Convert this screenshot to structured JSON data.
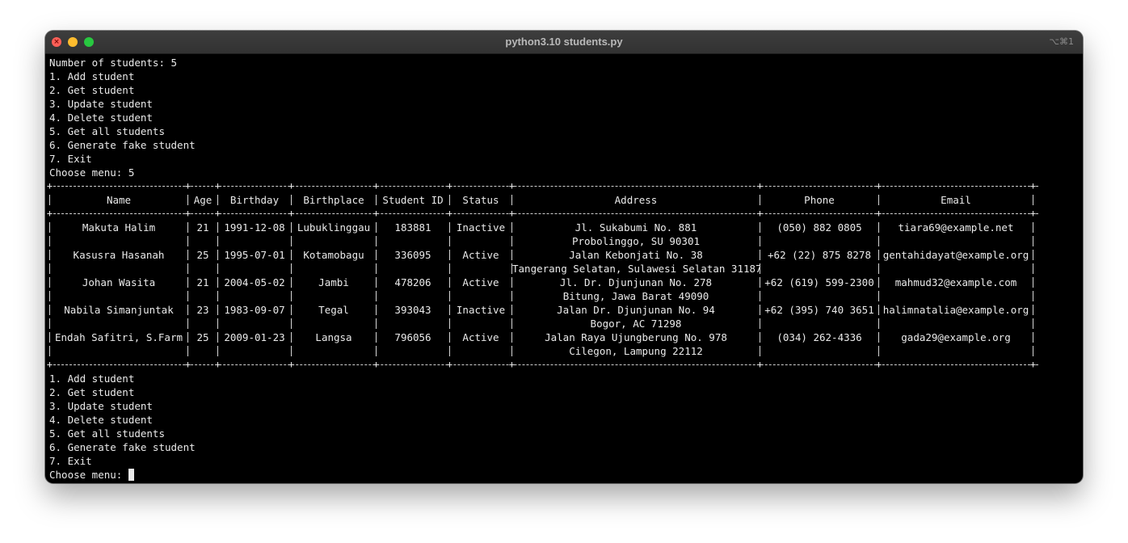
{
  "window": {
    "title": "python3.10 students.py",
    "shortcut": "⌥⌘1"
  },
  "session": {
    "student_count_line": "Number of students: 5",
    "menu_items": [
      "1. Add student",
      "2. Get student",
      "3. Update student",
      "4. Delete student",
      "5. Get all students",
      "6. Generate fake student",
      "7. Exit"
    ],
    "first_prompt": "Choose menu: 5",
    "second_prompt": "Choose menu: "
  },
  "table": {
    "headers": [
      "Name",
      "Age",
      "Birthday",
      "Birthplace",
      "Student ID",
      "Status",
      "Address",
      "Phone",
      "Email"
    ],
    "rows": [
      {
        "line1": [
          "Makuta Halim",
          "21",
          "1991-12-08",
          "Lubuklinggau",
          "183881",
          "Inactive",
          "Jl. Sukabumi No. 881",
          "(050) 882 0805",
          "tiara69@example.net"
        ],
        "line2": [
          "",
          "",
          "",
          "",
          "",
          "",
          "Probolinggo, SU 90301",
          "",
          ""
        ]
      },
      {
        "line1": [
          "Kasusra Hasanah",
          "25",
          "1995-07-01",
          "Kotamobagu",
          "336095",
          "Active",
          "Jalan Kebonjati No. 38",
          "+62 (22) 875 8278",
          "gentahidayat@example.org"
        ],
        "line2": [
          "",
          "",
          "",
          "",
          "",
          "",
          "Tangerang Selatan, Sulawesi Selatan 31187",
          "",
          ""
        ]
      },
      {
        "line1": [
          "Johan Wasita",
          "21",
          "2004-05-02",
          "Jambi",
          "478206",
          "Active",
          "Jl. Dr. Djunjunan No. 278",
          "+62 (619) 599-2300",
          "mahmud32@example.com"
        ],
        "line2": [
          "",
          "",
          "",
          "",
          "",
          "",
          "Bitung, Jawa Barat 49090",
          "",
          ""
        ]
      },
      {
        "line1": [
          "Nabila Simanjuntak",
          "23",
          "1983-09-07",
          "Tegal",
          "393043",
          "Inactive",
          "Jalan Dr. Djunjunan No. 94",
          "+62 (395) 740 3651",
          "halimnatalia@example.org"
        ],
        "line2": [
          "",
          "",
          "",
          "",
          "",
          "",
          "Bogor, AC 71298",
          "",
          ""
        ]
      },
      {
        "line1": [
          "Endah Safitri, S.Farm",
          "25",
          "2009-01-23",
          "Langsa",
          "796056",
          "Active",
          "Jalan Raya Ujungberung No. 978",
          "(034) 262-4336",
          "gada29@example.org"
        ],
        "line2": [
          "",
          "",
          "",
          "",
          "",
          "",
          "Cilegon, Lampung 22112",
          "",
          ""
        ]
      }
    ]
  },
  "colors": {
    "terminal_background": "#000000",
    "terminal_text": "#eaeaea",
    "titlebar": "#383838",
    "close_button": "#ff5f57",
    "minimize_button": "#febc2e",
    "maximize_button": "#28c840"
  }
}
